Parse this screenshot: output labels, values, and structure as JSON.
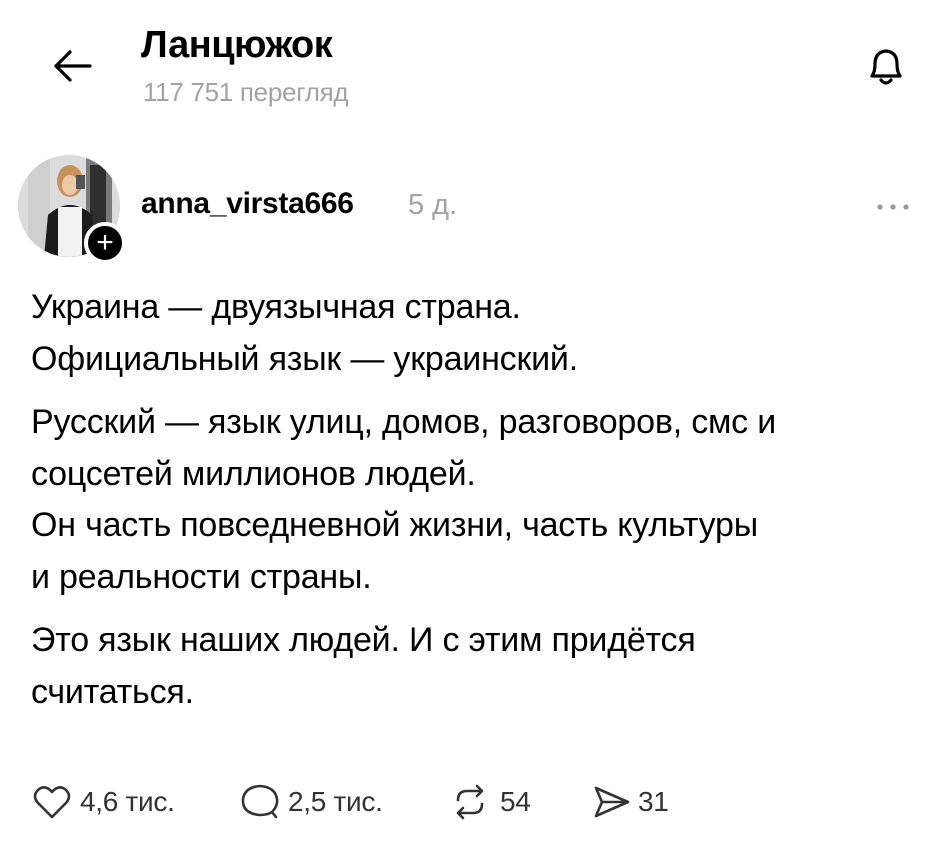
{
  "header": {
    "title": "Ланцюжок",
    "views": "117 751 перегляд",
    "back_icon": "arrow-left-icon",
    "bell_icon": "bell-icon"
  },
  "post": {
    "username": "anna_virsta666",
    "time": "5 д.",
    "avatar_badge": "+",
    "more_icon": "ellipsis-icon",
    "paragraphs": [
      [
        "Украина — двуязычная страна.",
        "Официальный язык — украинский."
      ],
      [
        "Русский — язык улиц, домов, разговоров, смс и",
        "соцсетей миллионов людей.",
        "Он часть повседневной жизни, часть культуры",
        "и реальности страны."
      ],
      [
        "Это язык наших людей. И с этим придётся",
        "считаться."
      ]
    ]
  },
  "actions": {
    "likes": "4,6 тис.",
    "replies": "2,5 тис.",
    "reposts": "54",
    "shares": "31"
  }
}
